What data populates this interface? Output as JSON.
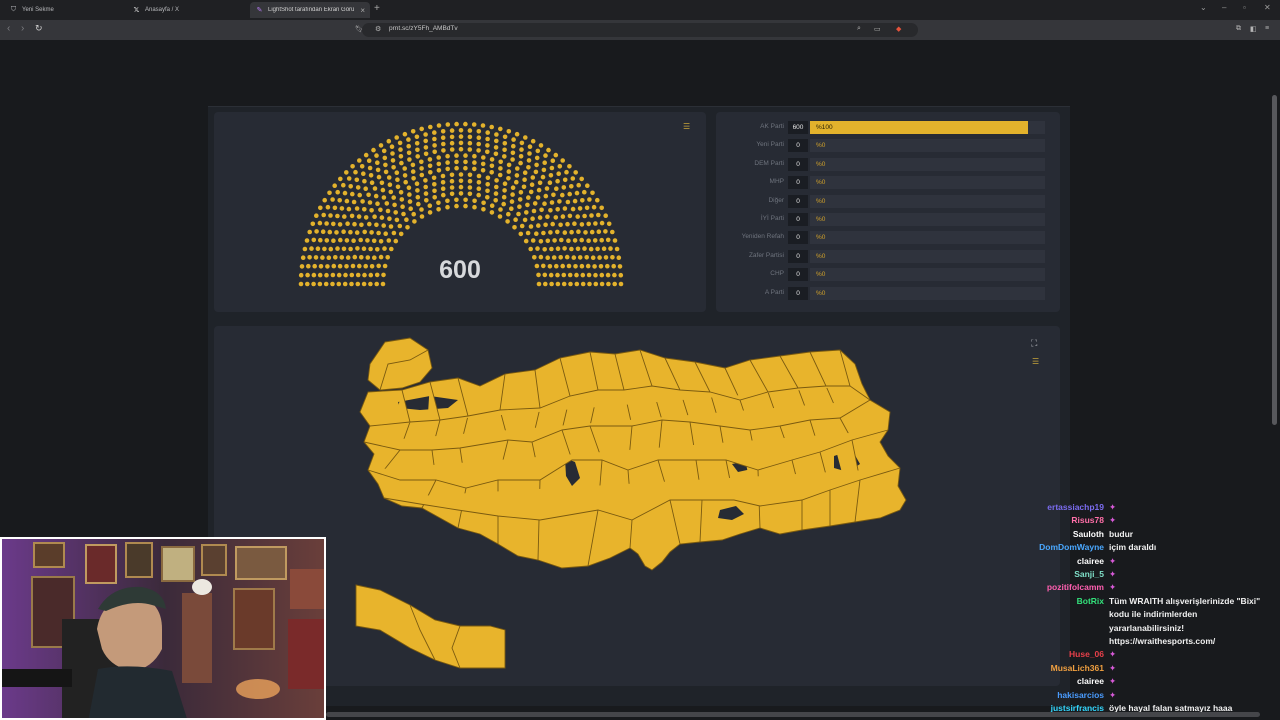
{
  "browser": {
    "tabs": [
      {
        "label": "Yeni Sekme",
        "icon": "shield-icon"
      },
      {
        "label": "Anasayfa / X",
        "icon": "x-icon"
      },
      {
        "label": "LightShot tarafından Ekran Görü",
        "icon": "feather-icon"
      }
    ],
    "url": "prnt.sc/zY5Fh_AMBdTv"
  },
  "parliament": {
    "total_seats": "600",
    "filled_seats": 600,
    "seat_color": "#e3b22c"
  },
  "parties": [
    {
      "name": "AK Parti",
      "seats": "600",
      "pct": "%100",
      "share": 1.0
    },
    {
      "name": "Yeni Parti",
      "seats": "0",
      "pct": "%0",
      "share": 0
    },
    {
      "name": "DEM Parti",
      "seats": "0",
      "pct": "%0",
      "share": 0
    },
    {
      "name": "MHP",
      "seats": "0",
      "pct": "%0",
      "share": 0
    },
    {
      "name": "Diğer",
      "seats": "0",
      "pct": "%0",
      "share": 0
    },
    {
      "name": "İYİ Parti",
      "seats": "0",
      "pct": "%0",
      "share": 0
    },
    {
      "name": "Yeniden Refah",
      "seats": "0",
      "pct": "%0",
      "share": 0
    },
    {
      "name": "Zafer Partisi",
      "seats": "0",
      "pct": "%0",
      "share": 0
    },
    {
      "name": "CHP",
      "seats": "0",
      "pct": "%0",
      "share": 0
    },
    {
      "name": "A Parti",
      "seats": "0",
      "pct": "%0",
      "share": 0
    }
  ],
  "map": {
    "fill_color": "#e8b42c",
    "border_color": "#7a5a10"
  },
  "chat": [
    {
      "user": "ertassiachp19",
      "msg": "",
      "color": "#7b6cf0"
    },
    {
      "user": "Risus78",
      "msg": "",
      "color": "#ff6fa8"
    },
    {
      "user": "Sauloth",
      "msg": "budur",
      "color": "#ffffff"
    },
    {
      "user": "DomDomWayne",
      "msg": "içim daraldı",
      "color": "#4aa8ff"
    },
    {
      "user": "clairee",
      "msg": "",
      "color": "#ffffff"
    },
    {
      "user": "Sanji_5",
      "msg": "",
      "color": "#7fe0c8"
    },
    {
      "user": "pozitifolcamm",
      "msg": "",
      "color": "#ff5fb0"
    },
    {
      "user": "BotRix",
      "msg": "Tüm WRAITH alışverişlerinizde \"Bixi\"",
      "color": "#33e07a"
    },
    {
      "user": "",
      "msg": "kodu ile indirimlerden",
      "color": "#ffffff"
    },
    {
      "user": "",
      "msg": "yararlanabilirsiniz!",
      "color": "#ffffff"
    },
    {
      "user": "",
      "msg": "https://wraithesports.com/",
      "color": "#ffffff"
    },
    {
      "user": "Huse_06",
      "msg": "",
      "color": "#e8404a"
    },
    {
      "user": "MusaLich361",
      "msg": "",
      "color": "#f0a040"
    },
    {
      "user": "clairee",
      "msg": "",
      "color": "#ffffff"
    },
    {
      "user": "hakisarcios",
      "msg": "",
      "color": "#4a9cff"
    },
    {
      "user": "justsirfrancis",
      "msg": "öyle hayal falan satmayız haaa",
      "color": "#34d8ff"
    }
  ]
}
